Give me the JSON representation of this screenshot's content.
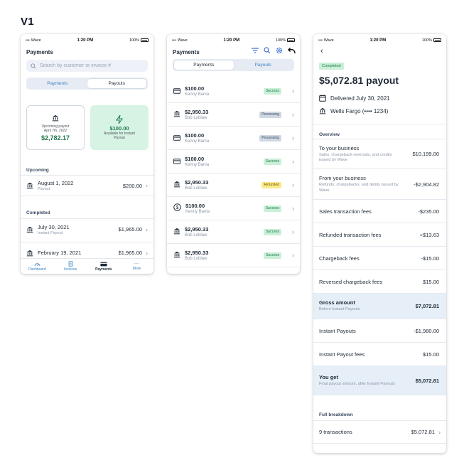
{
  "version_label": "V1",
  "status": {
    "carrier": "Wave",
    "time": "1:20 PM",
    "battery": "100%"
  },
  "phone1": {
    "title": "Payments",
    "search_placeholder": "Search by customer or invoice #",
    "tabs": [
      {
        "label": "Payments",
        "active": false
      },
      {
        "label": "Payouts",
        "active": true
      }
    ],
    "upcoming_card": {
      "line1": "Upcoming payout",
      "line2": "April 7th, 2022",
      "amount": "$2,782.17"
    },
    "instant_card": {
      "amount": "$100.00",
      "line1": "Available for Instant",
      "line2": "Payout"
    },
    "upcoming_label": "Upcoming",
    "upcoming_rows": [
      {
        "date": "August 1, 2022",
        "sub": "Payout",
        "amount": "$200.00"
      }
    ],
    "completed_label": "Completed",
    "completed_rows": [
      {
        "date": "July 30, 2021",
        "sub": "Instant Payout",
        "amount": "$1,965.00"
      },
      {
        "date": "February 19, 2021",
        "sub": "",
        "amount": "$1,965.00"
      }
    ],
    "tabbar": [
      {
        "label": "Dashboard",
        "icon": "dashboard-icon",
        "active": false
      },
      {
        "label": "Invoices",
        "icon": "invoice-icon",
        "active": false
      },
      {
        "label": "Payments",
        "icon": "card-icon",
        "active": true
      },
      {
        "label": "More",
        "icon": "more-icon",
        "active": false
      }
    ]
  },
  "phone2": {
    "title": "Payments",
    "tabs": [
      {
        "label": "Payments",
        "active": true
      },
      {
        "label": "Payouts",
        "active": false
      }
    ],
    "transactions": [
      {
        "amount": "$100.00",
        "name": "Kenny Bania",
        "status": "Success",
        "kind": "success",
        "icon": "card-icon"
      },
      {
        "amount": "$2,950.33",
        "name": "Bob Loblaw",
        "status": "Processing",
        "kind": "processing",
        "icon": "bank-icon"
      },
      {
        "amount": "$100.00",
        "name": "Kenny Bania",
        "status": "Processing",
        "kind": "processing",
        "icon": "card-icon"
      },
      {
        "amount": "$100.00",
        "name": "Kenny Bania",
        "status": "Success",
        "kind": "success",
        "icon": "card-icon"
      },
      {
        "amount": "$2,950.33",
        "name": "Bob Loblaw",
        "status": "Refunded",
        "kind": "refunded",
        "icon": "bank-icon"
      },
      {
        "amount": "$100.00",
        "name": "Kenny Bania",
        "status": "Success",
        "kind": "success",
        "icon": "dollar-icon"
      },
      {
        "amount": "$2,950.33",
        "name": "Bob Loblaw",
        "status": "Success",
        "kind": "success",
        "icon": "bank-icon"
      },
      {
        "amount": "$2,950.33",
        "name": "Bob Loblaw",
        "status": "Success",
        "kind": "success",
        "icon": "bank-icon"
      }
    ]
  },
  "phone3": {
    "badge": "Completed",
    "title": "$5,072.81 payout",
    "delivered": "Delivered July 30, 2021",
    "bank": "Wells Fargo (•••• 1234)",
    "overview_label": "Overview",
    "overview_rows": [
      {
        "label": "To your business",
        "sub": "Sales, chargeback reversals, and credits issued by Wave",
        "value": "$10,199.00",
        "highlight": false
      },
      {
        "label": "From your business",
        "sub": "Refunds, chargebacks, and debits issued by Wave",
        "value": "-$2,904.82",
        "highlight": false
      },
      {
        "label": "Sales transaction fees",
        "sub": "",
        "value": "-$235.00",
        "highlight": false
      },
      {
        "label": "Refunded transaction fees",
        "sub": "",
        "value": "+$13.63",
        "highlight": false
      },
      {
        "label": "Chargeback fees",
        "sub": "",
        "value": "-$15.00",
        "highlight": false
      },
      {
        "label": "Reversed chargeback fees",
        "sub": "",
        "value": "$15.00",
        "highlight": false
      },
      {
        "label": "Gross amount",
        "sub": "Before Instant Payouts",
        "value": "$7,072.81",
        "highlight": true
      },
      {
        "label": "Instant Payouts",
        "sub": "",
        "value": "-$1,980.00",
        "highlight": false
      },
      {
        "label": "Instant Payout fees",
        "sub": "",
        "value": "$15.00",
        "highlight": false
      },
      {
        "label": "You get",
        "sub": "Final payout amount, after Instant Payouts",
        "value": "$5,072.81",
        "highlight": true
      }
    ],
    "breakdown_label": "Full breakdown",
    "breakdown_row": {
      "label": "9 transactions",
      "value": "$5,072.81"
    }
  }
}
